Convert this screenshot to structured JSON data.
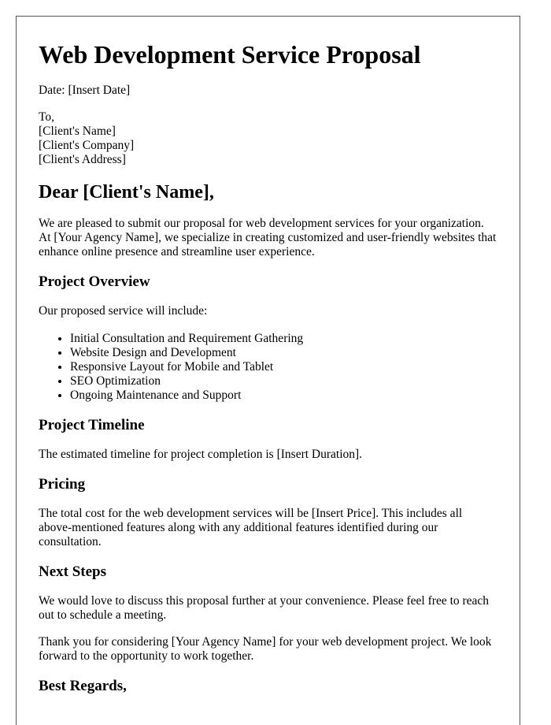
{
  "document": {
    "title": "Web Development Service Proposal",
    "date_line": "Date: [Insert Date]",
    "recipient": {
      "to": "To,",
      "name": "[Client's Name]",
      "company": "[Client's Company]",
      "address": "[Client's Address]"
    },
    "greeting": "Dear [Client's Name],",
    "intro": "We are pleased to submit our proposal for web development services for your organization. At [Your Agency Name], we specialize in creating customized and user-friendly websites that enhance online presence and streamline user experience.",
    "sections": {
      "overview": {
        "heading": "Project Overview",
        "text": "Our proposed service will include:",
        "items": [
          "Initial Consultation and Requirement Gathering",
          "Website Design and Development",
          "Responsive Layout for Mobile and Tablet",
          "SEO Optimization",
          "Ongoing Maintenance and Support"
        ]
      },
      "timeline": {
        "heading": "Project Timeline",
        "text": "The estimated timeline for project completion is [Insert Duration]."
      },
      "pricing": {
        "heading": "Pricing",
        "text": "The total cost for the web development services will be [Insert Price]. This includes all above-mentioned features along with any additional features identified during our consultation."
      },
      "next_steps": {
        "heading": "Next Steps",
        "text": "We would love to discuss this proposal further at your convenience. Please feel free to reach out to schedule a meeting."
      }
    },
    "thanks": "Thank you for considering [Your Agency Name] for your web development project. We look forward to the opportunity to work together.",
    "closing": "Best Regards,"
  }
}
